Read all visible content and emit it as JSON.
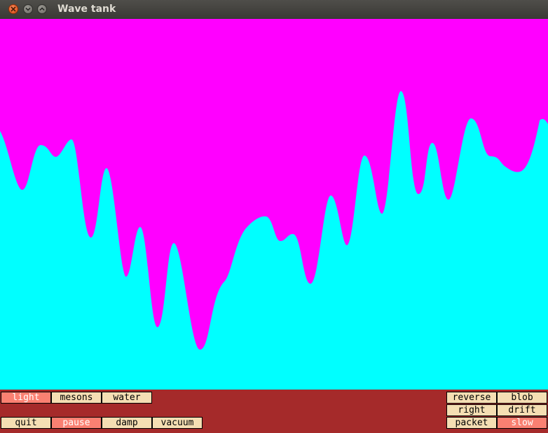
{
  "window": {
    "title": "Wave tank"
  },
  "colors": {
    "sky": "#ff00ff",
    "water": "#00ffff",
    "panel": "#a52a2a",
    "button": "#f5deb3",
    "button_active": "#fa8072"
  },
  "left_buttons": {
    "light": {
      "label": "light",
      "active": true
    },
    "mesons": {
      "label": "mesons",
      "active": false
    },
    "water": {
      "label": "water",
      "active": false
    },
    "quit": {
      "label": "quit",
      "active": false
    },
    "pause": {
      "label": "pause",
      "active": true
    },
    "damp": {
      "label": "damp",
      "active": false
    },
    "vacuum": {
      "label": "vacuum",
      "active": false
    }
  },
  "right_buttons": {
    "reverse": {
      "label": "reverse",
      "active": false
    },
    "blob": {
      "label": "blob",
      "active": false
    },
    "right": {
      "label": "right",
      "active": false
    },
    "drift": {
      "label": "drift",
      "active": false
    },
    "packet": {
      "label": "packet",
      "active": false
    },
    "slow": {
      "label": "slow",
      "active": true
    }
  }
}
